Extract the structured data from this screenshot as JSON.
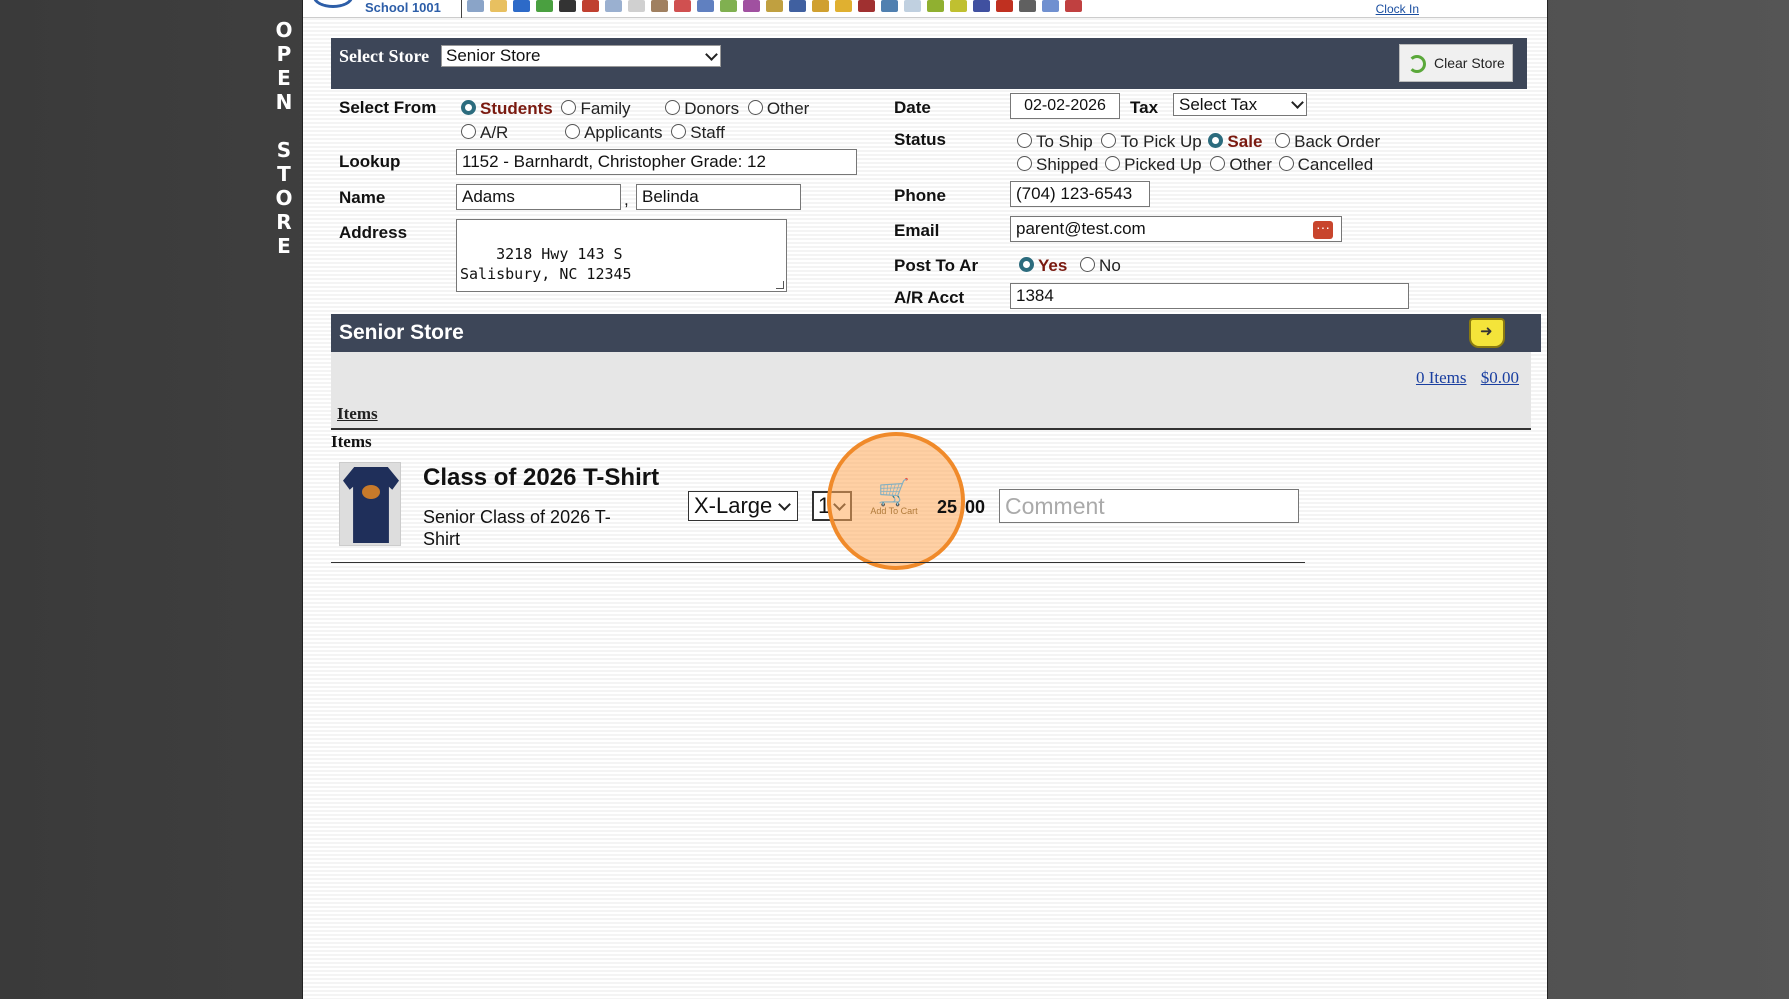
{
  "side_label_letters": [
    "O",
    "P",
    "E",
    "N",
    "",
    "S",
    "T",
    "O",
    "R",
    "E"
  ],
  "topbar": {
    "school_name": "School 1001",
    "clock_in": "Clock In"
  },
  "store_bar": {
    "label": "Select Store",
    "selected_store": "Senior Store",
    "clear_button": "Clear Store"
  },
  "select_from": {
    "label": "Select From",
    "options": [
      "Students",
      "Family",
      "Donors",
      "Other",
      "A/R",
      "Applicants",
      "Staff"
    ],
    "selected": "Students"
  },
  "lookup": {
    "label": "Lookup",
    "value": "1152 - Barnhardt, Christopher Grade: 12"
  },
  "name": {
    "label": "Name",
    "last": "Adams",
    "first": "Belinda",
    "separator": ","
  },
  "address": {
    "label": "Address",
    "value": "3218 Hwy 143 S\nSalisbury, NC 12345"
  },
  "date": {
    "label": "Date",
    "value": "02-02-2026"
  },
  "tax": {
    "label": "Tax",
    "selected": "Select Tax"
  },
  "status": {
    "label": "Status",
    "options": [
      "To Ship",
      "To Pick Up",
      "Sale",
      "Back Order",
      "Shipped",
      "Picked Up",
      "Other",
      "Cancelled"
    ],
    "selected": "Sale"
  },
  "phone": {
    "label": "Phone",
    "value": "(704) 123-6543"
  },
  "email": {
    "label": "Email",
    "value": "parent@test.com"
  },
  "post_to_ar": {
    "label": "Post To Ar",
    "yes": "Yes",
    "no": "No",
    "selected": "Yes"
  },
  "ar_acct": {
    "label": "A/R Acct",
    "value": "1384"
  },
  "section": {
    "title": "Senior Store",
    "cart_items": "0 Items",
    "cart_total": "$0.00",
    "items_link": "Items",
    "items_heading": "Items"
  },
  "product": {
    "title": "Class of 2026 T-Shirt",
    "description": "Senior Class of 2026 T-Shirt",
    "size": "X-Large",
    "quantity": "1",
    "price_left": "25",
    "price_right": "00",
    "add_to_cart": "Add To Cart",
    "comment_placeholder": "Comment"
  },
  "colors": {
    "header_bar": "#3d4658",
    "radio_selected": "#2c6c7e",
    "selected_label": "#7a1a10",
    "highlight": "#f08a2a"
  }
}
